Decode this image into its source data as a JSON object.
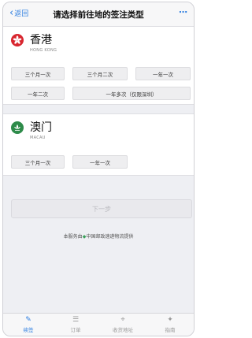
{
  "navbar": {
    "back_label": "返回",
    "title": "请选择前往地的签注类型",
    "more_label": "⋯"
  },
  "regions": [
    {
      "name": "香港",
      "subtitle": "HONG KONG",
      "options": [
        "三个月一次",
        "三个月二次",
        "一年一次",
        "一年二次",
        "一年多次（仅限深圳）"
      ]
    },
    {
      "name": "澳门",
      "subtitle": "MACAU",
      "options": [
        "三个月一次",
        "一年一次"
      ]
    }
  ],
  "next_button": "下一步",
  "service_note_prefix": "本服务由",
  "service_note_suffix": "中国邮政速递物流提供",
  "tabbar": {
    "tabs": [
      {
        "label": "续签",
        "icon": "edit-icon",
        "active": true
      },
      {
        "label": "订单",
        "icon": "order-icon",
        "active": false
      },
      {
        "label": "收货地址",
        "icon": "location-icon",
        "active": false
      },
      {
        "label": "指南",
        "icon": "guide-icon",
        "active": false
      }
    ]
  },
  "colors": {
    "accent": "#2f7fe0",
    "hk_red": "#d8262f",
    "macau_green": "#2e8b4a"
  }
}
